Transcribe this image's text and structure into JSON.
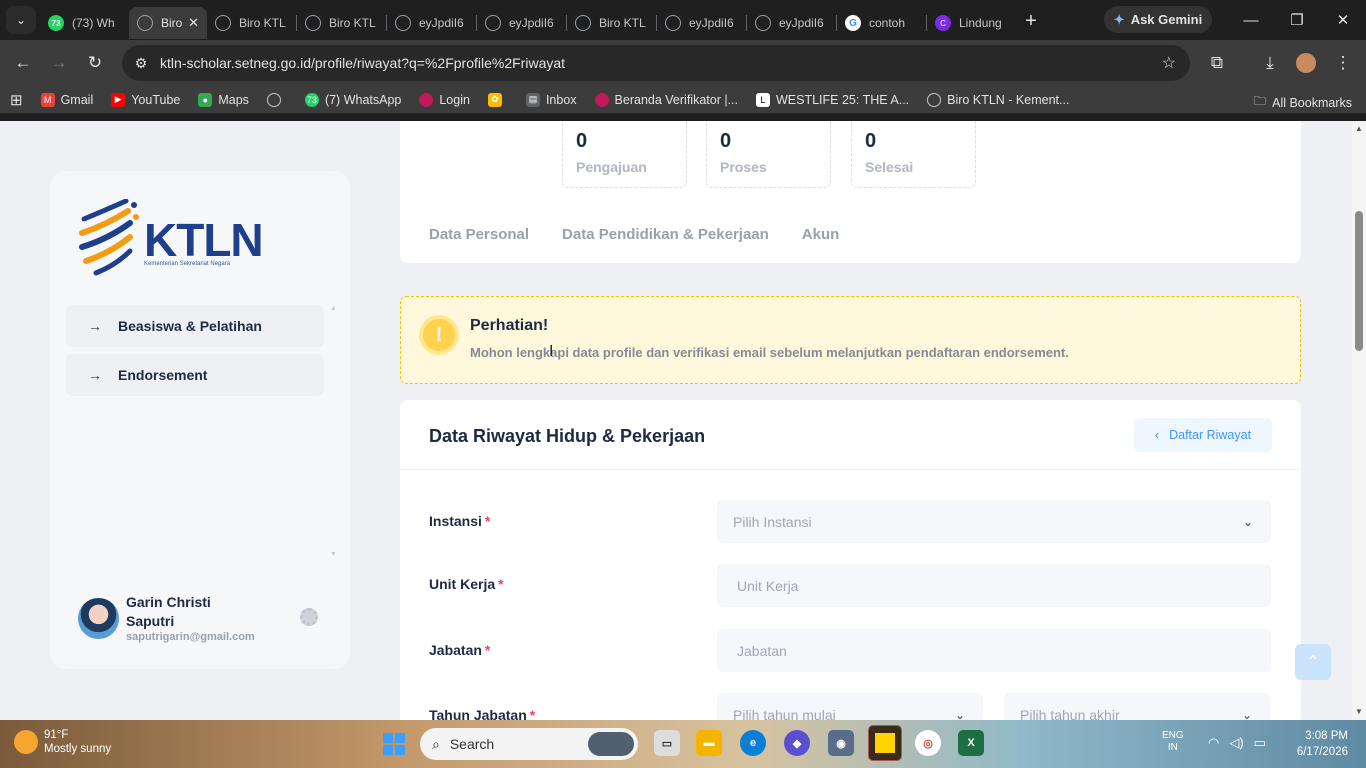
{
  "browser": {
    "tabs": [
      {
        "title": "(73) Wh",
        "favicon": "whatsapp",
        "active": false
      },
      {
        "title": "Biro",
        "favicon": "globe",
        "active": true
      },
      {
        "title": "Biro KTL",
        "favicon": "globe",
        "active": false
      },
      {
        "title": "Biro KTL",
        "favicon": "globe",
        "active": false
      },
      {
        "title": "eyJpdiI6",
        "favicon": "globe",
        "active": false
      },
      {
        "title": "eyJpdiI6",
        "favicon": "globe",
        "active": false
      },
      {
        "title": "Biro KTL",
        "favicon": "globe",
        "active": false
      },
      {
        "title": "eyJpdiI6",
        "favicon": "globe",
        "active": false
      },
      {
        "title": "eyJpdiI6",
        "favicon": "globe",
        "active": false
      },
      {
        "title": "contoh",
        "favicon": "google",
        "active": false
      },
      {
        "title": "Lindung",
        "favicon": "canva",
        "active": false
      }
    ],
    "gemini_label": "Ask Gemini",
    "url": "ktln-scholar.setneg.go.id/profile/riwayat?q=%2Fprofile%2Friwayat",
    "bookmarks": [
      {
        "label": "Gmail",
        "icon": "gmail-icon",
        "color": "#ea4335"
      },
      {
        "label": "YouTube",
        "icon": "youtube-icon",
        "color": "#ff0000"
      },
      {
        "label": "Maps",
        "icon": "maps-icon",
        "color": "#34a853"
      },
      {
        "label": "",
        "icon": "globe-icon",
        "color": "#9aa0a6"
      },
      {
        "label": "(7) WhatsApp",
        "icon": "whatsapp-icon",
        "color": "#25d366"
      },
      {
        "label": "Login",
        "icon": "login-icon",
        "color": "#c2185b"
      },
      {
        "label": "",
        "icon": "pinwheel-icon",
        "color": "#fbbc04"
      },
      {
        "label": "Inbox",
        "icon": "inbox-icon",
        "color": "#9aa0a6"
      },
      {
        "label": "Beranda Verifikator |...",
        "icon": "verifikator-icon",
        "color": "#c2185b"
      },
      {
        "label": "WESTLIFE 25: THE A...",
        "icon": "letter-l-icon",
        "color": "#ffffff"
      },
      {
        "label": "Biro KTLN - Kement...",
        "icon": "globe-icon",
        "color": "#9aa0a6"
      }
    ],
    "all_bookmarks": "All Bookmarks",
    "wa_badge": "73"
  },
  "sidebar": {
    "logo_text": "KTLN",
    "logo_sub": "Kementerian Sekretariat Negara",
    "nav": [
      {
        "label": "Beasiswa & Pelatihan"
      },
      {
        "label": "Endorsement"
      }
    ],
    "user": {
      "name": "Garin Christi Saputri",
      "email": "saputrigarin@gmail.com"
    }
  },
  "stats": [
    {
      "value": "0",
      "label": "Pengajuan"
    },
    {
      "value": "0",
      "label": "Proses"
    },
    {
      "value": "0",
      "label": "Selesai"
    }
  ],
  "profile_tabs": [
    "Data Personal",
    "Data Pendidikan & Pekerjaan",
    "Akun"
  ],
  "notice": {
    "title": "Perhatian!",
    "text": "Mohon lengkapi data profile dan verifikasi email sebelum melanjutkan pendaftaran endorsement."
  },
  "form": {
    "title": "Data Riwayat Hidup & Pekerjaan",
    "back_button": "Daftar Riwayat",
    "required_mark": "*",
    "fields": {
      "instansi": {
        "label": "Instansi",
        "placeholder": "Pilih Instansi"
      },
      "unit_kerja": {
        "label": "Unit Kerja",
        "placeholder": "Unit Kerja"
      },
      "jabatan": {
        "label": "Jabatan",
        "placeholder": "Jabatan"
      },
      "tahun_jabatan": {
        "label": "Tahun Jabatan",
        "start_placeholder": "Pilih tahun mulai",
        "end_placeholder": "Pilih tahun akhir"
      }
    }
  },
  "taskbar": {
    "weather_temp": "91°F",
    "weather_desc": "Mostly sunny",
    "search_placeholder": "Search",
    "lang": "ENG",
    "lang_region": "IN",
    "time": "3:08 PM",
    "date": "6/17/2026"
  },
  "colors": {
    "accent_blue": "#3e97ff",
    "warning_yellow": "#f6c000",
    "required_red": "#f1416c",
    "brand_navy": "#1e3f8c"
  }
}
